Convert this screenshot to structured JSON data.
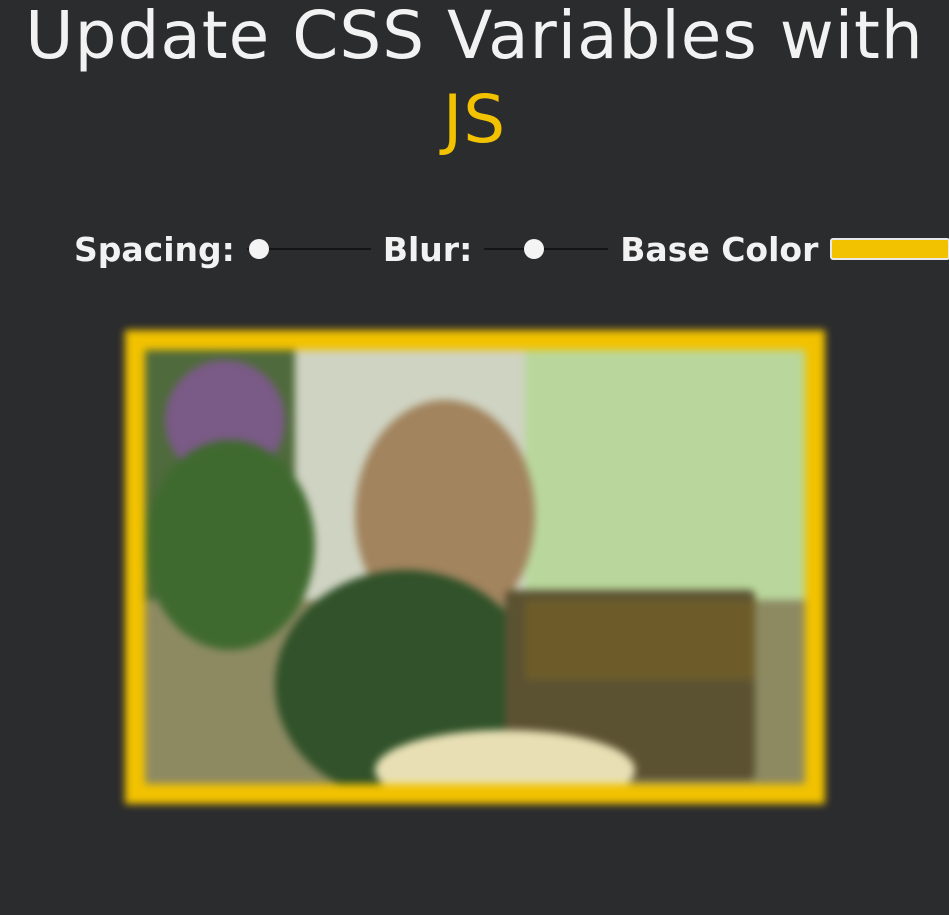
{
  "header": {
    "title_main": "Update CSS Variables with",
    "title_highlight": "JS"
  },
  "controls": {
    "spacing": {
      "label": "Spacing:",
      "value_fraction": 0.1
    },
    "blur": {
      "label": "Blur:",
      "value_fraction": 0.4
    },
    "base_color": {
      "label": "Base Color",
      "value": "#f2c200"
    }
  },
  "colors": {
    "background": "#2b2c2e",
    "accent": "#f2c200",
    "text": "#f2f2f2"
  },
  "image": {
    "description_icon": "blurred-photo"
  }
}
